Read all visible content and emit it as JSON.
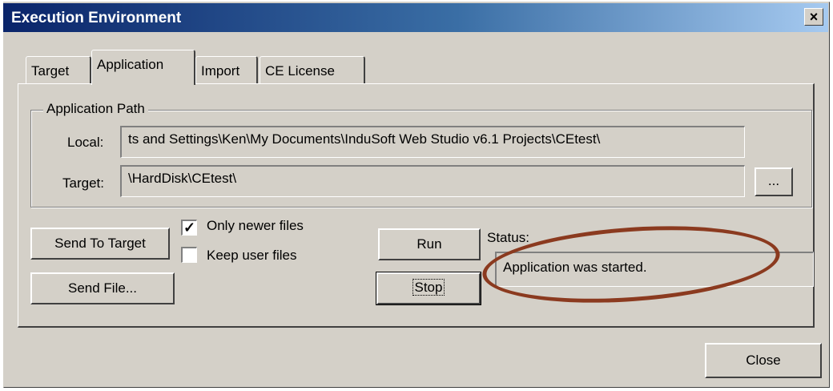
{
  "window": {
    "title": "Execution Environment",
    "close_glyph": "×"
  },
  "tabs": [
    {
      "label": "Target",
      "active": false
    },
    {
      "label": "Application",
      "active": true
    },
    {
      "label": "Import",
      "active": false
    },
    {
      "label": "CE License",
      "active": false
    }
  ],
  "application_path": {
    "legend": "Application Path",
    "local_label": "Local:",
    "local_value": "ts and Settings\\Ken\\My Documents\\InduSoft Web Studio v6.1 Projects\\CEtest\\",
    "target_label": "Target:",
    "target_value": "\\HardDisk\\CEtest\\",
    "browse_label": "..."
  },
  "actions": {
    "send_to_target": "Send To Target",
    "send_file": "Send File...",
    "only_newer_label": "Only newer files",
    "only_newer_checked": true,
    "keep_user_label": "Keep user files",
    "keep_user_checked": false,
    "run": "Run",
    "stop": "Stop"
  },
  "status": {
    "label": "Status:",
    "value": "Application was started."
  },
  "footer": {
    "close": "Close"
  },
  "annotation": {
    "ellipse_color": "#8b3a1f"
  },
  "icons": {
    "checkmark": "check-icon"
  }
}
